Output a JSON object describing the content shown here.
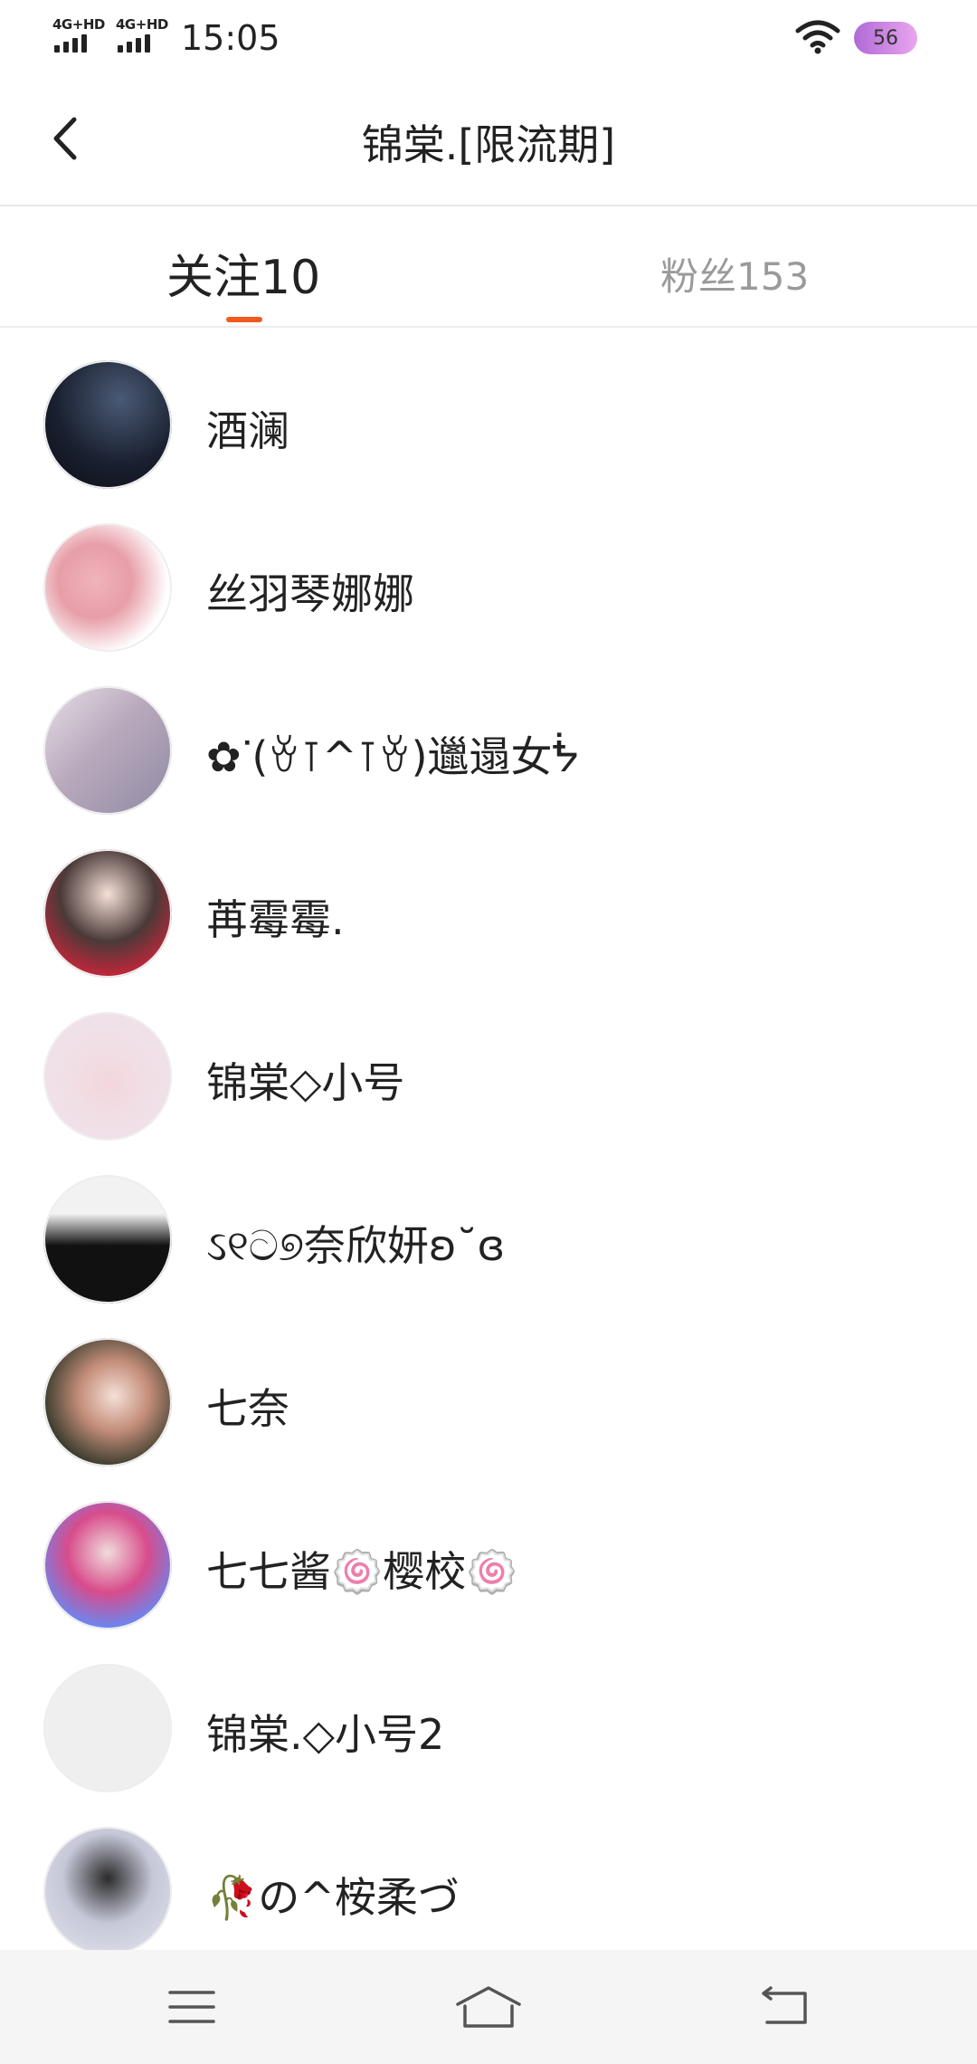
{
  "status": {
    "signal1": "4G+HD",
    "signal2": "4G+HD",
    "time": "15:05",
    "battery": "56"
  },
  "header": {
    "title": "锦棠.[限流期]"
  },
  "tabs": {
    "following": "关注10",
    "followers": "粉丝153"
  },
  "users": [
    {
      "name": "酒澜"
    },
    {
      "name": "丝羽琴娜娜"
    },
    {
      "name": "✿ᐝ(ꈊ⊺^⊺ꈊ)邋遢女ᖭ"
    },
    {
      "name": "苒霉霉."
    },
    {
      "name": "锦棠◇小号"
    },
    {
      "name": "ઽ୧ට୭奈欣妍ʚ˘ɞ"
    },
    {
      "name": "七奈"
    },
    {
      "name": "七七酱🍥樱校🍥"
    },
    {
      "name": "锦棠.◇小号2"
    },
    {
      "name": "🥀の^桉柔づ"
    }
  ],
  "icons": {
    "back": "back-arrow-icon",
    "menu": "menu-icon",
    "home": "home-icon",
    "return": "return-icon"
  },
  "colors": {
    "accent": "#f15a1e",
    "inactive_tab": "#9a9a9a"
  }
}
